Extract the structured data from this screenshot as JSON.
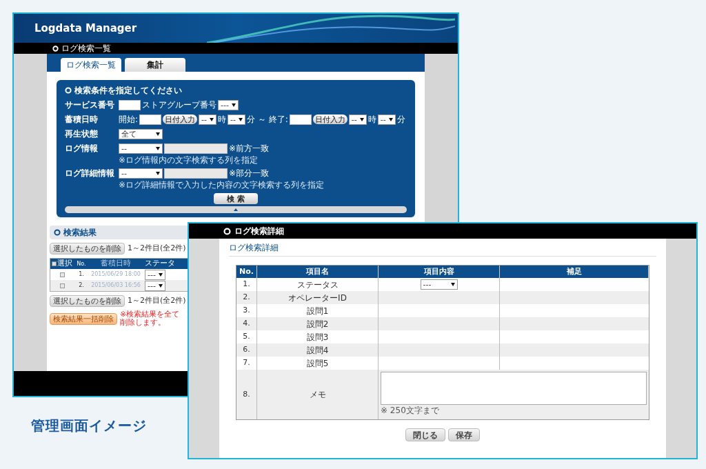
{
  "back_window": {
    "app_title": "Logdata Manager",
    "page_title": "ログ検索一覧",
    "tabs": [
      {
        "label": "ログ検索一覧",
        "selected": true
      },
      {
        "label": "集計",
        "selected": false
      }
    ],
    "search_form": {
      "title": "検索条件を指定してください",
      "rows": [
        {
          "label": "サービス番号",
          "items": [
            {
              "kind": "input"
            },
            {
              "kind": "text",
              "text": "ストアグループ番号"
            },
            {
              "kind": "select",
              "value": "---"
            }
          ]
        },
        {
          "label": "蓄積日時",
          "items": [
            {
              "kind": "text",
              "text": "開始:"
            },
            {
              "kind": "input"
            },
            {
              "kind": "button",
              "text": "日付入力"
            },
            {
              "kind": "select",
              "value": "--"
            },
            {
              "kind": "text",
              "text": "時"
            },
            {
              "kind": "select",
              "value": "--"
            },
            {
              "kind": "text",
              "text": "分 ～ 終了:"
            },
            {
              "kind": "input"
            },
            {
              "kind": "button",
              "text": "日付入力"
            },
            {
              "kind": "select",
              "value": "--"
            },
            {
              "kind": "text",
              "text": "時"
            },
            {
              "kind": "select",
              "value": "--"
            },
            {
              "kind": "text",
              "text": "分"
            }
          ]
        },
        {
          "label": "再生状態",
          "items": [
            {
              "kind": "wide_select",
              "value": "全て"
            }
          ]
        },
        {
          "label": "ログ情報",
          "items": [
            {
              "kind": "wide_select",
              "value": "--"
            },
            {
              "kind": "wide_input"
            },
            {
              "kind": "text",
              "text": "※前方一致"
            }
          ],
          "note": "※ログ情報内の文字検索する列を指定"
        },
        {
          "label": "ログ詳細情報",
          "items": [
            {
              "kind": "wide_select",
              "value": "--"
            },
            {
              "kind": "wide_input"
            },
            {
              "kind": "text",
              "text": "※部分一致"
            }
          ],
          "note": "※ログ詳細情報で入力した内容の文字検索する列を指定"
        }
      ],
      "search_button": "検 索"
    },
    "results": {
      "title": "検索結果",
      "top_pager": {
        "delete_button": "選択したものを削除",
        "range": "1～2件目(全2件)"
      },
      "all_checked": false,
      "columns": [
        "選択",
        "No.",
        "蓄積日時",
        "ステータ"
      ],
      "rows": [
        {
          "checked": false,
          "no": "1.",
          "datetime": "2015/06/29 18:00",
          "status": "---"
        },
        {
          "checked": false,
          "no": "2.",
          "datetime": "2015/06/03 16:56",
          "status": "---"
        }
      ],
      "bottom_pager": {
        "delete_button": "選択したものを削除",
        "range": "1～2件目(全2件)"
      },
      "bulk_delete_button": "検索結果一括削除",
      "warning": "※検索結果を全て削除します。"
    }
  },
  "front_window": {
    "page_title": "ログ検索詳細",
    "breadcrumb": "ログ検索詳細",
    "columns": [
      "No.",
      "項目名",
      "項目内容",
      "補足"
    ],
    "rows": [
      {
        "no": "1.",
        "name": "ステータス",
        "kind": "select",
        "value": "---"
      },
      {
        "no": "2.",
        "name": "オペレーターID",
        "kind": "plain"
      },
      {
        "no": "3.",
        "name": "設問1",
        "kind": "plain"
      },
      {
        "no": "4.",
        "name": "設問2",
        "kind": "plain"
      },
      {
        "no": "5.",
        "name": "設問3",
        "kind": "plain"
      },
      {
        "no": "6.",
        "name": "設問4",
        "kind": "plain"
      },
      {
        "no": "7.",
        "name": "設問5",
        "kind": "plain"
      },
      {
        "no": "8.",
        "name": "メモ",
        "kind": "memo",
        "note": "※ 250文字まで"
      }
    ],
    "buttons": [
      "閉じる",
      "保存"
    ]
  },
  "caption": "管理画面イメージ"
}
